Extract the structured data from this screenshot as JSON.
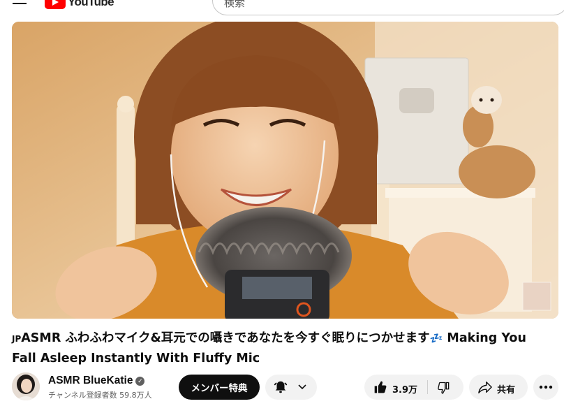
{
  "header": {
    "menu_icon": "hamburger-menu-icon",
    "logo_text": "YouTube",
    "search_placeholder": "検索"
  },
  "video": {
    "title_prefix": "JP",
    "title_main": "ASMR ふわふわマイク&耳元での囁きであなたを今すぐ眠りにつかせます",
    "title_emoji": "💤",
    "title_suffix": "Making You Fall Asleep Instantly With Fluffy Mic"
  },
  "channel": {
    "name": "ASMR BlueKatie",
    "verified_icon": "verified-check-icon",
    "subscribers": "チャンネル登録者数 59.8万人"
  },
  "actions": {
    "member_label": "メンバー特典",
    "bell_icon": "bell-icon",
    "chevron_icon": "chevron-down-icon",
    "like_icon": "thumbs-up-icon",
    "like_count": "3.9万",
    "dislike_icon": "thumbs-down-icon",
    "share_icon": "share-arrow-icon",
    "share_label": "共有",
    "more_icon": "more-horizontal-icon"
  },
  "colors": {
    "brand_red": "#ff0000",
    "button_bg": "#f2f2f2",
    "member_bg": "#0f0f0f",
    "secondary_text": "#606060"
  }
}
